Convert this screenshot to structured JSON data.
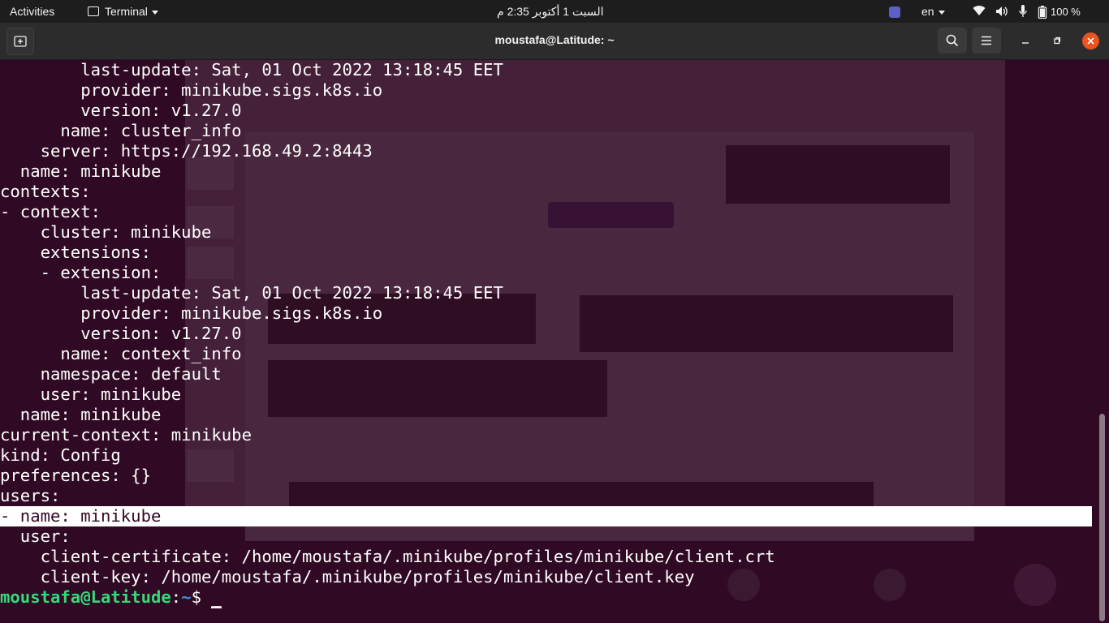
{
  "topbar": {
    "activities": "Activities",
    "app_name": "Terminal",
    "clock": "السبت 1 أكتوبر  2:35 م",
    "language": "en",
    "battery": "100 %"
  },
  "window": {
    "title": "moustafa@Latitude: ~"
  },
  "terminal": {
    "lines": [
      "        last-update: Sat, 01 Oct 2022 13:18:45 EET",
      "        provider: minikube.sigs.k8s.io",
      "        version: v1.27.0",
      "      name: cluster_info",
      "    server: https://192.168.49.2:8443",
      "  name: minikube",
      "contexts:",
      "- context:",
      "    cluster: minikube",
      "    extensions:",
      "    - extension:",
      "        last-update: Sat, 01 Oct 2022 13:18:45 EET",
      "        provider: minikube.sigs.k8s.io",
      "        version: v1.27.0",
      "      name: context_info",
      "    namespace: default",
      "    user: minikube",
      "  name: minikube",
      "current-context: minikube",
      "kind: Config",
      "preferences: {}",
      "users:",
      "- name: minikube",
      "  user:",
      "    client-certificate: /home/moustafa/.minikube/profiles/minikube/client.crt",
      "    client-key: /home/moustafa/.minikube/profiles/minikube/client.key"
    ],
    "selected_line": "- name: minikube",
    "prompt": {
      "user_host": "moustafa@Latitude",
      "colon": ":",
      "path": "~",
      "symbol": "$ ",
      "cursor": "_"
    },
    "colors": {
      "background": "#300a24",
      "text": "#ffffff",
      "prompt_user": "#33da7a",
      "prompt_path": "#4a90d9"
    }
  }
}
